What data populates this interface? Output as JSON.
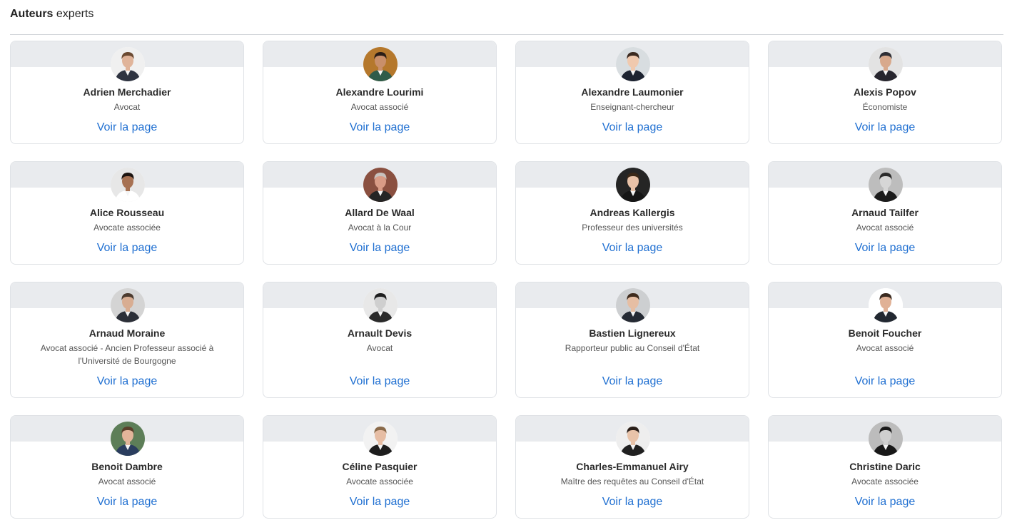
{
  "header": {
    "bold": "Auteurs",
    "rest": "experts"
  },
  "link_label": "Voir la page",
  "authors": [
    {
      "name": "Adrien Merchadier",
      "role": "Avocat",
      "bg": "#f0f0f0",
      "skin": "#e0b49a",
      "hair": "#6b4a32",
      "suit": "#2e3340"
    },
    {
      "name": "Alexandre Lourimi",
      "role": "Avocat associé",
      "bg": "#b5782c",
      "skin": "#c98f6a",
      "hair": "#2a1d16",
      "suit": "#2f5c4a"
    },
    {
      "name": "Alexandre Laumonier",
      "role": "Enseignant-chercheur",
      "bg": "#d8dde0",
      "skin": "#f0c9ae",
      "hair": "#3b2a20",
      "suit": "#1d2330"
    },
    {
      "name": "Alexis Popov",
      "role": "Économiste",
      "bg": "#e3e3e3",
      "skin": "#d8a98c",
      "hair": "#2f2f35",
      "suit": "#27262e"
    },
    {
      "name": "Alice Rousseau",
      "role": "Avocate associée",
      "bg": "#e7e7e7",
      "skin": "#a77152",
      "hair": "#1d1410",
      "suit": "#ffffff"
    },
    {
      "name": "Allard De Waal",
      "role": "Avocat à la Cour",
      "bg": "#8a5040",
      "skin": "#d99c86",
      "hair": "#c7c2bd",
      "suit": "#252525"
    },
    {
      "name": "Andreas Kallergis",
      "role": "Professeur des universités",
      "bg": "#252525",
      "skin": "#e9c2a8",
      "hair": "#3a2818",
      "suit": "#161616"
    },
    {
      "name": "Arnaud Tailfer",
      "role": "Avocat associé",
      "bg": "#bdbdbd",
      "skin": "#d6d6d6",
      "hair": "#2a2a2a",
      "suit": "#1b1b1b"
    },
    {
      "name": "Arnaud Moraine",
      "role": "Avocat associé - Ancien Professeur associé à l'Université de Bourgogne",
      "bg": "#d4d4d4",
      "skin": "#d8ad92",
      "hair": "#4b3a2e",
      "suit": "#2c2f38"
    },
    {
      "name": "Arnault Devis",
      "role": "Avocat",
      "bg": "#e8e8e8",
      "skin": "#cfcfcf",
      "hair": "#1e1e1e",
      "suit": "#2a2a2a"
    },
    {
      "name": "Bastien Lignereux",
      "role": "Rapporteur public au Conseil d'État",
      "bg": "#cdcfd1",
      "skin": "#e6bea3",
      "hair": "#3e2b1d",
      "suit": "#252a33"
    },
    {
      "name": "Benoit Foucher",
      "role": "Avocat associé",
      "bg": "#ffffff",
      "skin": "#e0b196",
      "hair": "#3a2a20",
      "suit": "#222831"
    },
    {
      "name": "Benoit Dambre",
      "role": "Avocat associé",
      "bg": "#5d7e58",
      "skin": "#e2b59a",
      "hair": "#5a3f2b",
      "suit": "#2a3d5e"
    },
    {
      "name": "Céline Pasquier",
      "role": "Avocate associée",
      "bg": "#f2f2f2",
      "skin": "#e6bda4",
      "hair": "#8a6a4a",
      "suit": "#1d1d1d"
    },
    {
      "name": "Charles-Emmanuel Airy",
      "role": "Maître des requêtes au Conseil d'État",
      "bg": "#eeeeee",
      "skin": "#e8c3a9",
      "hair": "#2a1e18",
      "suit": "#202020"
    },
    {
      "name": "Christine Daric",
      "role": "Avocate associée",
      "bg": "#bcbcbc",
      "skin": "#cfcfcf",
      "hair": "#1a1a1a",
      "suit": "#181818"
    }
  ]
}
